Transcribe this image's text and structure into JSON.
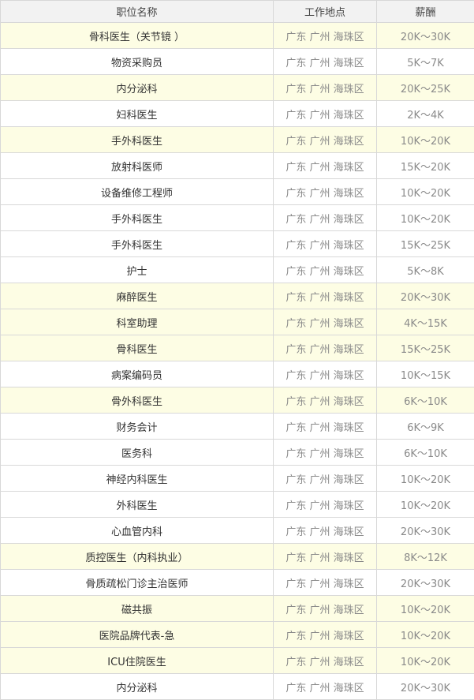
{
  "table": {
    "headers": {
      "title": "职位名称",
      "location": "工作地点",
      "salary": "薪酬"
    },
    "rows": [
      {
        "title": "骨科医生（关节镜 ）",
        "location": "广东 广州 海珠区",
        "salary": "20K～30K",
        "highlight": true
      },
      {
        "title": "物资采购员",
        "location": "广东 广州 海珠区",
        "salary": "5K～7K",
        "highlight": false
      },
      {
        "title": "内分泌科",
        "location": "广东 广州 海珠区",
        "salary": "20K～25K",
        "highlight": true
      },
      {
        "title": "妇科医生",
        "location": "广东 广州 海珠区",
        "salary": "2K～4K",
        "highlight": false
      },
      {
        "title": "手外科医生",
        "location": "广东 广州 海珠区",
        "salary": "10K～20K",
        "highlight": true
      },
      {
        "title": "放射科医师",
        "location": "广东 广州 海珠区",
        "salary": "15K～20K",
        "highlight": false
      },
      {
        "title": "设备维修工程师",
        "location": "广东 广州 海珠区",
        "salary": "10K～20K",
        "highlight": false
      },
      {
        "title": "手外科医生",
        "location": "广东 广州 海珠区",
        "salary": "10K～20K",
        "highlight": false
      },
      {
        "title": "手外科医生",
        "location": "广东 广州 海珠区",
        "salary": "15K～25K",
        "highlight": false
      },
      {
        "title": "护士",
        "location": "广东 广州 海珠区",
        "salary": "5K～8K",
        "highlight": false
      },
      {
        "title": "麻醉医生",
        "location": "广东 广州 海珠区",
        "salary": "20K～30K",
        "highlight": true
      },
      {
        "title": "科室助理",
        "location": "广东 广州 海珠区",
        "salary": "4K～15K",
        "highlight": true
      },
      {
        "title": "骨科医生",
        "location": "广东 广州 海珠区",
        "salary": "15K～25K",
        "highlight": true
      },
      {
        "title": "病案编码员",
        "location": "广东 广州 海珠区",
        "salary": "10K～15K",
        "highlight": false
      },
      {
        "title": "骨外科医生",
        "location": "广东 广州 海珠区",
        "salary": "6K～10K",
        "highlight": true
      },
      {
        "title": "财务会计",
        "location": "广东 广州 海珠区",
        "salary": "6K～9K",
        "highlight": false
      },
      {
        "title": "医务科",
        "location": "广东 广州 海珠区",
        "salary": "6K～10K",
        "highlight": false
      },
      {
        "title": "神经内科医生",
        "location": "广东 广州 海珠区",
        "salary": "10K～20K",
        "highlight": false
      },
      {
        "title": "外科医生",
        "location": "广东 广州 海珠区",
        "salary": "10K～20K",
        "highlight": false
      },
      {
        "title": "心血管内科",
        "location": "广东 广州 海珠区",
        "salary": "20K～30K",
        "highlight": false
      },
      {
        "title": "质控医生（内科执业）",
        "location": "广东 广州 海珠区",
        "salary": "8K～12K",
        "highlight": true
      },
      {
        "title": "骨质疏松门诊主治医师",
        "location": "广东 广州 海珠区",
        "salary": "20K～30K",
        "highlight": false
      },
      {
        "title": "磁共振",
        "location": "广东 广州 海珠区",
        "salary": "10K～20K",
        "highlight": true
      },
      {
        "title": "医院品牌代表-急",
        "location": "广东 广州 海珠区",
        "salary": "10K～20K",
        "highlight": true
      },
      {
        "title": "ICU住院医生",
        "location": "广东 广州 海珠区",
        "salary": "10K～20K",
        "highlight": true
      },
      {
        "title": "内分泌科",
        "location": "广东 广州 海珠区",
        "salary": "20K～30K",
        "highlight": false
      }
    ]
  }
}
